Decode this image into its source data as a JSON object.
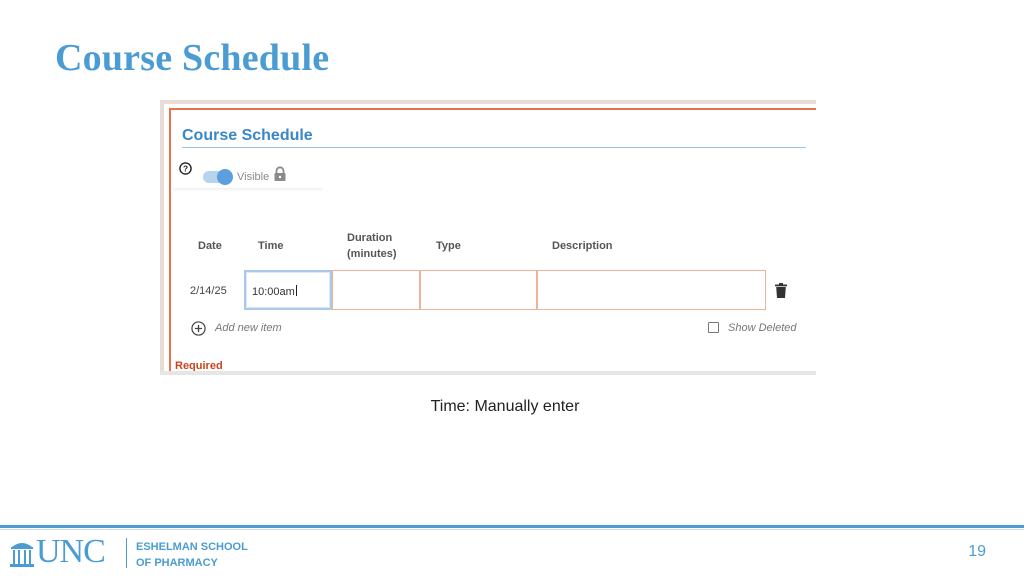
{
  "slide": {
    "title": "Course Schedule",
    "caption": "Time: Manually enter",
    "page_number": "19"
  },
  "panel": {
    "title": "Course Schedule",
    "visible_label": "Visible",
    "visible_toggle_on": true,
    "columns": {
      "date": "Date",
      "time": "Time",
      "duration_line1": "Duration",
      "duration_line2": "(minutes)",
      "type": "Type",
      "description": "Description"
    },
    "rows": [
      {
        "date": "2/14/25",
        "time": "10:00am",
        "duration": "",
        "type": "",
        "description": ""
      }
    ],
    "add_new_item": "Add new item",
    "show_deleted": "Show Deleted",
    "show_deleted_checked": false,
    "required": "Required",
    "icons": [
      "help-icon",
      "lock-icon",
      "trash-icon",
      "add-circle-icon"
    ]
  },
  "footer": {
    "logo_text": "UNC",
    "school_line1": "ESHELMAN SCHOOL",
    "school_line2": "OF PHARMACY"
  },
  "colors": {
    "brand_blue": "#4b9cd3",
    "required_red": "#c8441e",
    "field_border": "#efb39c"
  }
}
